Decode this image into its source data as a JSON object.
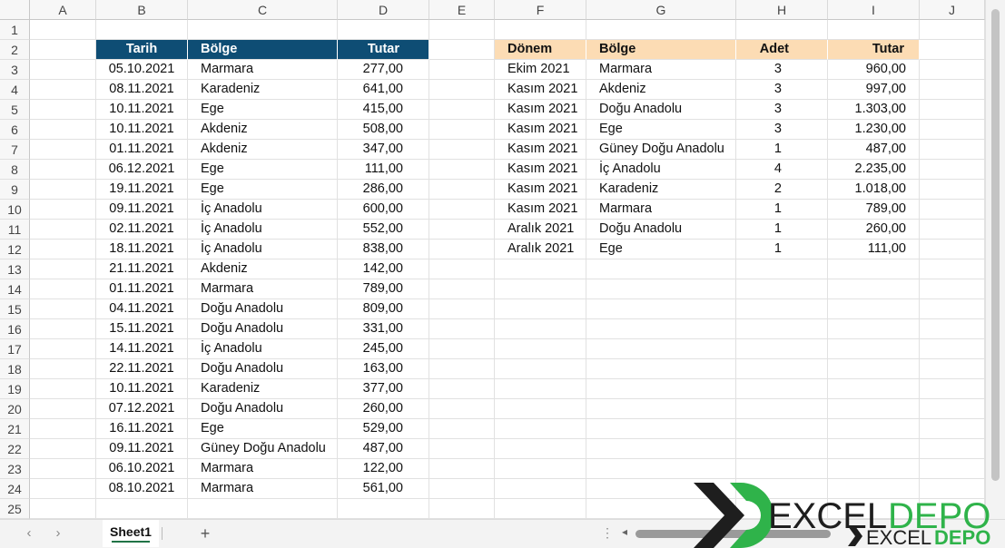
{
  "columns": [
    "A",
    "B",
    "C",
    "D",
    "E",
    "F",
    "G",
    "H",
    "I",
    "J"
  ],
  "rows": [
    "1",
    "2",
    "3",
    "4",
    "5",
    "6",
    "7",
    "8",
    "9",
    "10",
    "11",
    "12",
    "13",
    "14",
    "15",
    "16",
    "17",
    "18",
    "19",
    "20",
    "21",
    "22",
    "23",
    "24",
    "25"
  ],
  "table1": {
    "headers": [
      "Tarih",
      "Bölge",
      "Tutar"
    ],
    "rows": [
      [
        "05.10.2021",
        "Marmara",
        "277,00"
      ],
      [
        "08.11.2021",
        "Karadeniz",
        "641,00"
      ],
      [
        "10.11.2021",
        "Ege",
        "415,00"
      ],
      [
        "10.11.2021",
        "Akdeniz",
        "508,00"
      ],
      [
        "01.11.2021",
        "Akdeniz",
        "347,00"
      ],
      [
        "06.12.2021",
        "Ege",
        "111,00"
      ],
      [
        "19.11.2021",
        "Ege",
        "286,00"
      ],
      [
        "09.11.2021",
        "İç Anadolu",
        "600,00"
      ],
      [
        "02.11.2021",
        "İç Anadolu",
        "552,00"
      ],
      [
        "18.11.2021",
        "İç Anadolu",
        "838,00"
      ],
      [
        "21.11.2021",
        "Akdeniz",
        "142,00"
      ],
      [
        "01.11.2021",
        "Marmara",
        "789,00"
      ],
      [
        "04.11.2021",
        "Doğu Anadolu",
        "809,00"
      ],
      [
        "15.11.2021",
        "Doğu Anadolu",
        "331,00"
      ],
      [
        "14.11.2021",
        "İç Anadolu",
        "245,00"
      ],
      [
        "22.11.2021",
        "Doğu Anadolu",
        "163,00"
      ],
      [
        "10.11.2021",
        "Karadeniz",
        "377,00"
      ],
      [
        "07.12.2021",
        "Doğu Anadolu",
        "260,00"
      ],
      [
        "16.11.2021",
        "Ege",
        "529,00"
      ],
      [
        "09.11.2021",
        "Güney Doğu Anadolu",
        "487,00"
      ],
      [
        "06.10.2021",
        "Marmara",
        "122,00"
      ],
      [
        "08.10.2021",
        "Marmara",
        "561,00"
      ]
    ]
  },
  "table2": {
    "headers": [
      "Dönem",
      "Bölge",
      "Adet",
      "Tutar"
    ],
    "rows": [
      [
        "Ekim 2021",
        "Marmara",
        "3",
        "960,00"
      ],
      [
        "Kasım 2021",
        "Akdeniz",
        "3",
        "997,00"
      ],
      [
        "Kasım 2021",
        "Doğu Anadolu",
        "3",
        "1.303,00"
      ],
      [
        "Kasım 2021",
        "Ege",
        "3",
        "1.230,00"
      ],
      [
        "Kasım 2021",
        "Güney Doğu Anadolu",
        "1",
        "487,00"
      ],
      [
        "Kasım 2021",
        "İç Anadolu",
        "4",
        "2.235,00"
      ],
      [
        "Kasım 2021",
        "Karadeniz",
        "2",
        "1.018,00"
      ],
      [
        "Kasım 2021",
        "Marmara",
        "1",
        "789,00"
      ],
      [
        "Aralık 2021",
        "Doğu Anadolu",
        "1",
        "260,00"
      ],
      [
        "Aralık 2021",
        "Ege",
        "1",
        "111,00"
      ]
    ]
  },
  "tabs": {
    "sheet": "Sheet1",
    "add": "+",
    "prev": "‹",
    "next": "›"
  },
  "logo": {
    "text": "EXCELDEPO",
    "part1": "EXCEL",
    "part2": "DEPO"
  },
  "colors": {
    "header_blue": "#0e4d74",
    "header_peach": "#fcdcb4",
    "logo_green": "#2fb34a",
    "logo_dark": "#1e1e1e"
  }
}
